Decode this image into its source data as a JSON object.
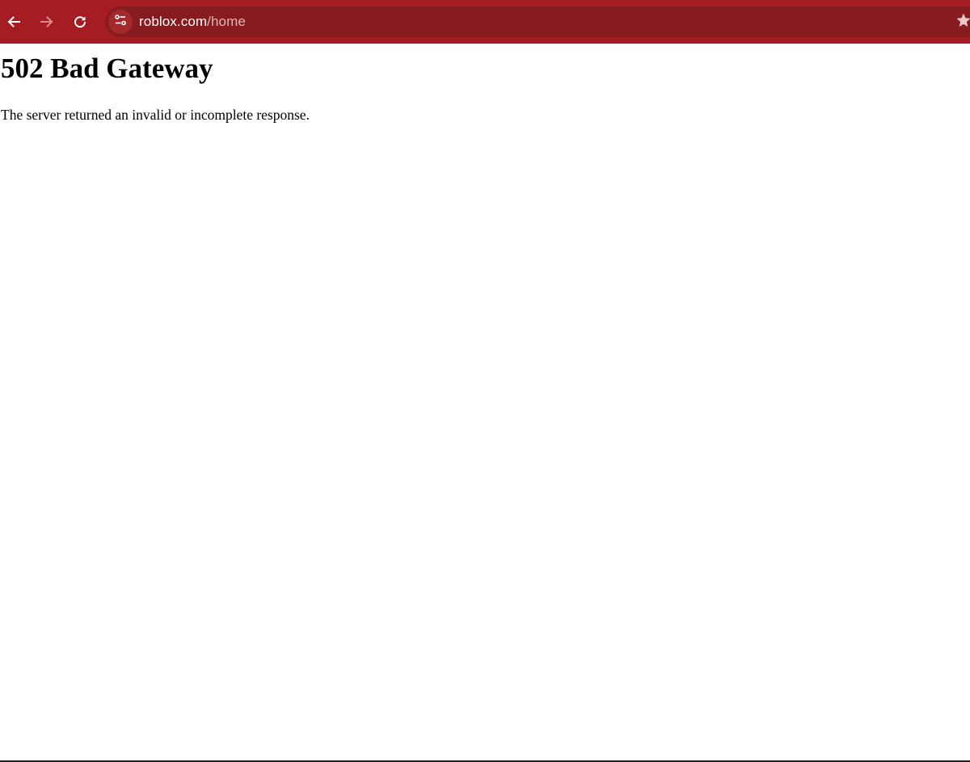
{
  "browser": {
    "url_host": "roblox.com",
    "url_path": "/home",
    "colors": {
      "toolbar": "#a51d22",
      "omnibox": "#861c1f",
      "url_text": "#ffffff",
      "url_path_text": "#e3b3b3"
    },
    "icons": {
      "back": "arrow-left-icon",
      "forward": "arrow-right-icon",
      "reload": "reload-icon",
      "site_info": "tune-icon",
      "bookmark": "star-icon"
    }
  },
  "page": {
    "heading": "502 Bad Gateway",
    "message": "The server returned an invalid or incomplete response."
  }
}
